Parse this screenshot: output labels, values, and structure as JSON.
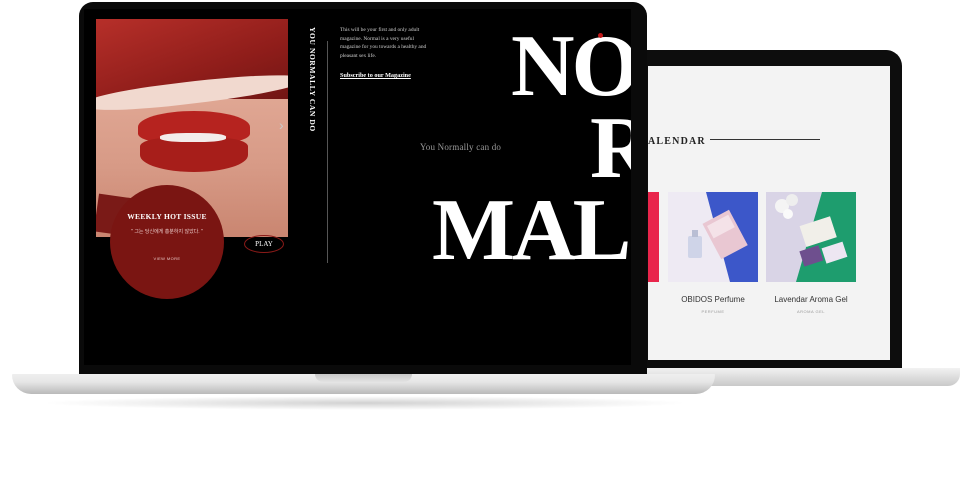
{
  "front_site": {
    "vertical_title": "YOU NORMALLY CAN DO",
    "intro_text": "This will be your first and only adult magazine. Normal is a very useful magazine for you towards a healthy and pleasant sex life.",
    "subscribe_link": "Subscribe to our Magazine",
    "tagline": "You Normally can do",
    "big_words": [
      "NO",
      "R",
      "MAL"
    ],
    "weekly_hot": {
      "title": "WEEKLY HOT ISSUE",
      "quote": "\" 그는 당신에게 흥분하지 않았다. \"",
      "more": "VIEW MORE"
    },
    "play_button": "PLAY",
    "next_arrow": "›",
    "accent_color": "#7a1512"
  },
  "back_site": {
    "section_title": "ALENDAR",
    "products": [
      {
        "name": "OBIDOS Perfume",
        "category": "PERFUME"
      },
      {
        "name": "Lavendar Aroma Gel",
        "category": "AROMA GEL"
      }
    ]
  },
  "colors": {
    "brand_red": "#b6231f",
    "dark": "#000000",
    "light_bg": "#f3f3f3",
    "product_blue": "#3c57c9",
    "product_green": "#1e9d6e",
    "product_pink": "#e9254b"
  }
}
